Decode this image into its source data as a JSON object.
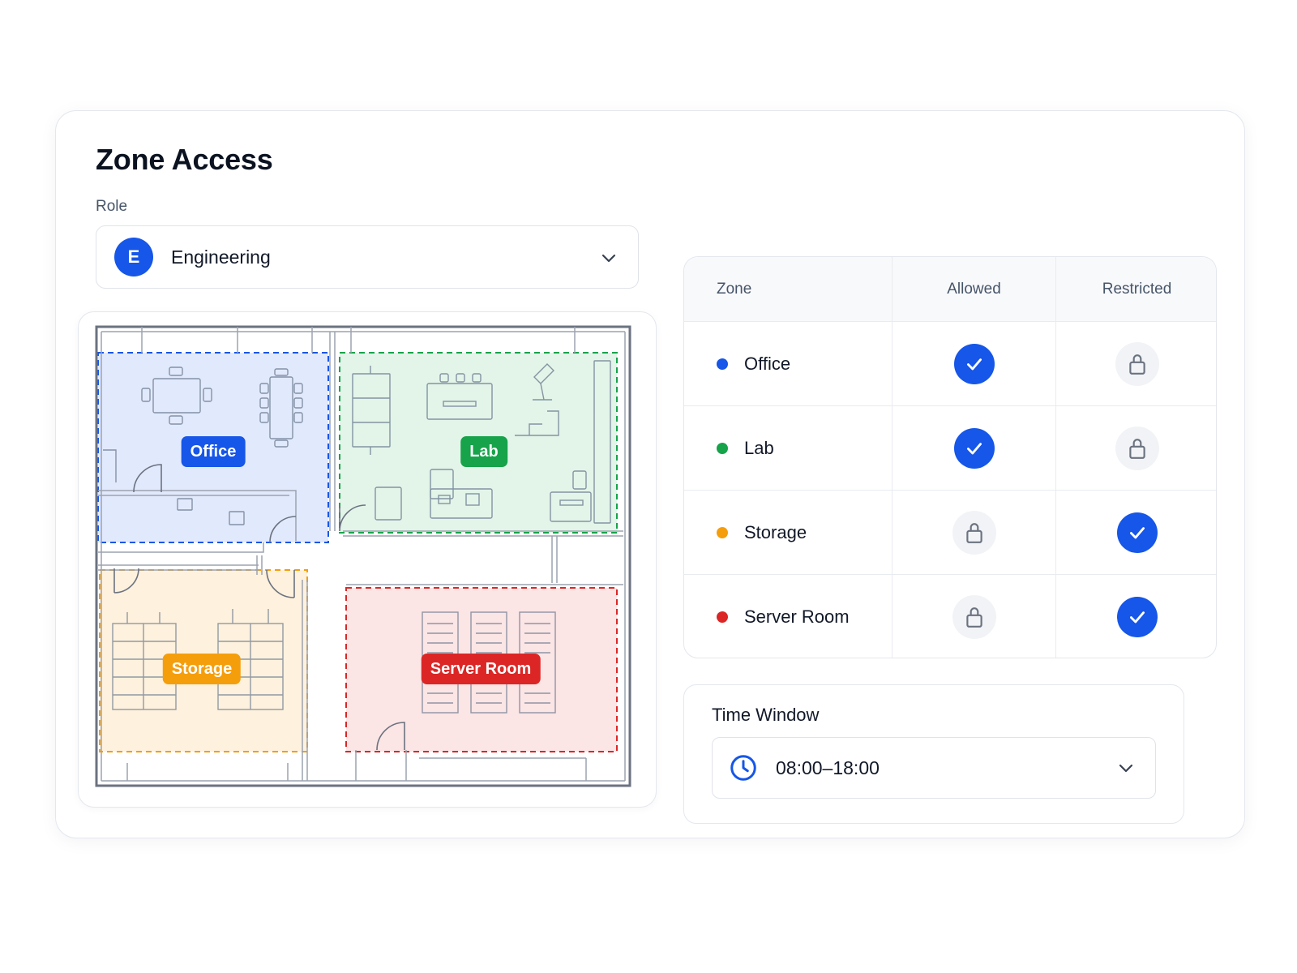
{
  "header": {
    "title": "Zone Access"
  },
  "role": {
    "label": "Role",
    "avatar_letter": "E",
    "value": "Engineering",
    "chevron_icon": "chevron-down-icon",
    "accent": "#1656e8"
  },
  "map": {
    "zones": [
      {
        "label": "Office",
        "color": "#1656e8"
      },
      {
        "label": "Lab",
        "color": "#16a34a"
      },
      {
        "label": "Storage",
        "color": "#f59e0b"
      },
      {
        "label": "Server Room",
        "color": "#dc2626"
      }
    ]
  },
  "table": {
    "headers": {
      "zone": "Zone",
      "allowed": "Allowed",
      "restricted": "Restricted"
    },
    "rows": [
      {
        "zone": "Office",
        "color": "#1656e8",
        "allowed": "check-icon",
        "restricted": "lock-icon"
      },
      {
        "zone": "Lab",
        "color": "#16a34a",
        "allowed": "check-icon",
        "restricted": "lock-icon"
      },
      {
        "zone": "Storage",
        "color": "#f59e0b",
        "allowed": "lock-icon",
        "restricted": "check-icon"
      },
      {
        "zone": "Server Room",
        "color": "#dc2626",
        "allowed": "lock-icon",
        "restricted": "check-icon"
      }
    ]
  },
  "time_window": {
    "label": "Time Window",
    "value": "08:00–18:00",
    "icon": "clock-icon",
    "chevron_icon": "chevron-down-icon"
  }
}
